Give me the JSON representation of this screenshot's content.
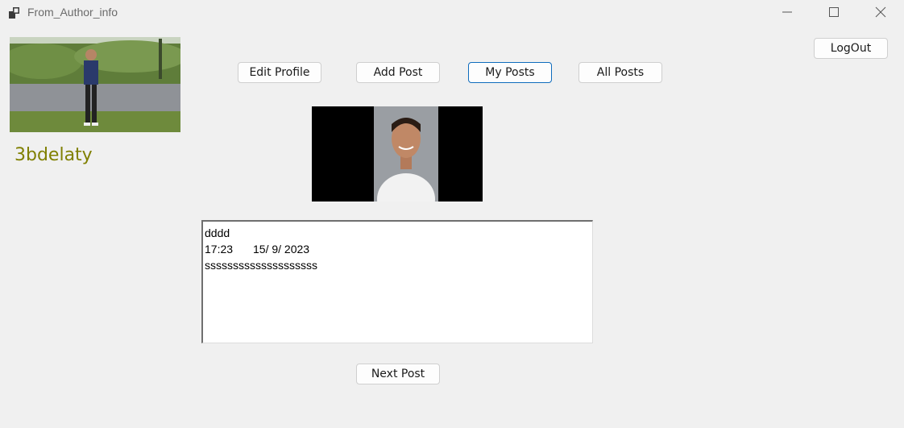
{
  "window": {
    "title": "From_Author_info",
    "icon": "app-window-icon",
    "controls": [
      "minimize-icon",
      "maximize-icon",
      "close-icon"
    ]
  },
  "profile": {
    "username": "3bdelaty",
    "photo": "user-profile-photo",
    "username_color": "#808000"
  },
  "nav": {
    "edit_profile": "Edit Profile",
    "add_post": "Add Post",
    "my_posts": "My Posts",
    "all_posts": "All Posts",
    "logout": "LogOut",
    "selected": "my_posts",
    "accent": "#0f6cbd"
  },
  "post": {
    "image": "post-photo",
    "title": "dddd",
    "time": "17:23",
    "date": "15/ 9/ 2023",
    "body": "ssssssssssssssssssss"
  },
  "footer": {
    "next_post": "Next Post"
  }
}
